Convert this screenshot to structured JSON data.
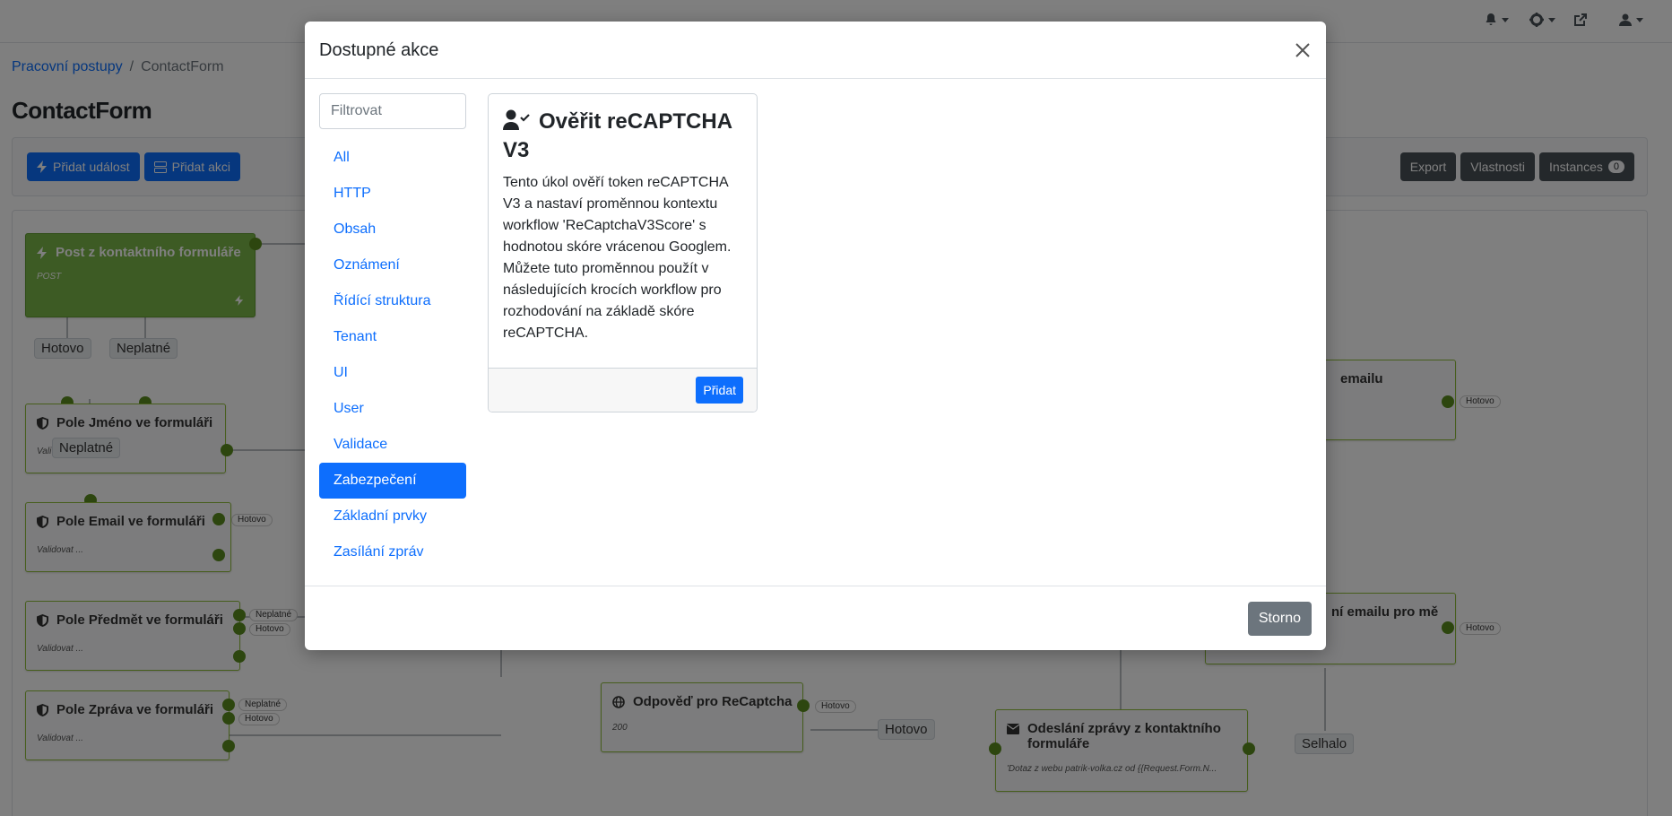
{
  "breadcrumb": {
    "parent": "Pracovní postupy",
    "separator": "/",
    "current": "ContactForm"
  },
  "page_title": "ContactForm",
  "toolbar": {
    "add_event": "Přidat událost",
    "add_action": "Přidat akci",
    "export": "Export",
    "properties": "Vlastnosti",
    "instances": "Instances",
    "instances_count": "0"
  },
  "canvas": {
    "trigger": {
      "title": "Post z kontaktního formuláře",
      "subtitle": "POST"
    },
    "labels": {
      "hotovo": "Hotovo",
      "neplatne": "Neplatné",
      "selhalo": "Selhalo"
    },
    "nodes": {
      "jmeno": {
        "title": "Pole Jméno ve formuláři",
        "subtitle": "Vali"
      },
      "email": {
        "title": "Pole Email ve formuláři",
        "subtitle": "Validovat ..."
      },
      "predmet": {
        "title": "Pole Předmět ve formuláři",
        "subtitle": "Validovat ..."
      },
      "zprava": {
        "title": "Pole Zpráva ve formuláři",
        "subtitle": "Validovat ..."
      },
      "odpoved": {
        "title": "Odpověď pro ReCaptcha",
        "subtitle": "200"
      },
      "odeslani": {
        "title": "Odeslání zprávy z kontaktního formuláře",
        "subtitle": "'Dotaz z webu patrik-volka.cz od {{Request.Form.N..."
      },
      "right1": {
        "title": "emailu"
      },
      "right2": {
        "title": "ní emailu pro mě"
      },
      "right_partial_tag": "o"
    }
  },
  "modal": {
    "title": "Dostupné akce",
    "filter_placeholder": "Filtrovat",
    "categories": [
      "All",
      "HTTP",
      "Obsah",
      "Oznámení",
      "Řídící struktura",
      "Tenant",
      "UI",
      "User",
      "Validace",
      "Zabezpečení",
      "Základní prvky",
      "Zasílání zpráv"
    ],
    "active_category": "Zabezpečení",
    "card": {
      "icon": "user-check-icon",
      "title": "Ověřit reCAPTCHA V3",
      "description": "Tento úkol ověří token reCAPTCHA V3 a nastaví proměnnou kontextu workflow 'ReCaptchaV3Score' s hodnotou skóre vrácenou Googlem. Můžete tuto proměnnou použít v následujících krocích workflow pro rozhodování na základě skóre reCAPTCHA.",
      "add_button": "Přidat"
    },
    "cancel_button": "Storno"
  },
  "colors": {
    "primary": "#0d6efd",
    "secondary": "#6c757d",
    "node_green": "#7ab648",
    "port": "#5b8c1f"
  }
}
